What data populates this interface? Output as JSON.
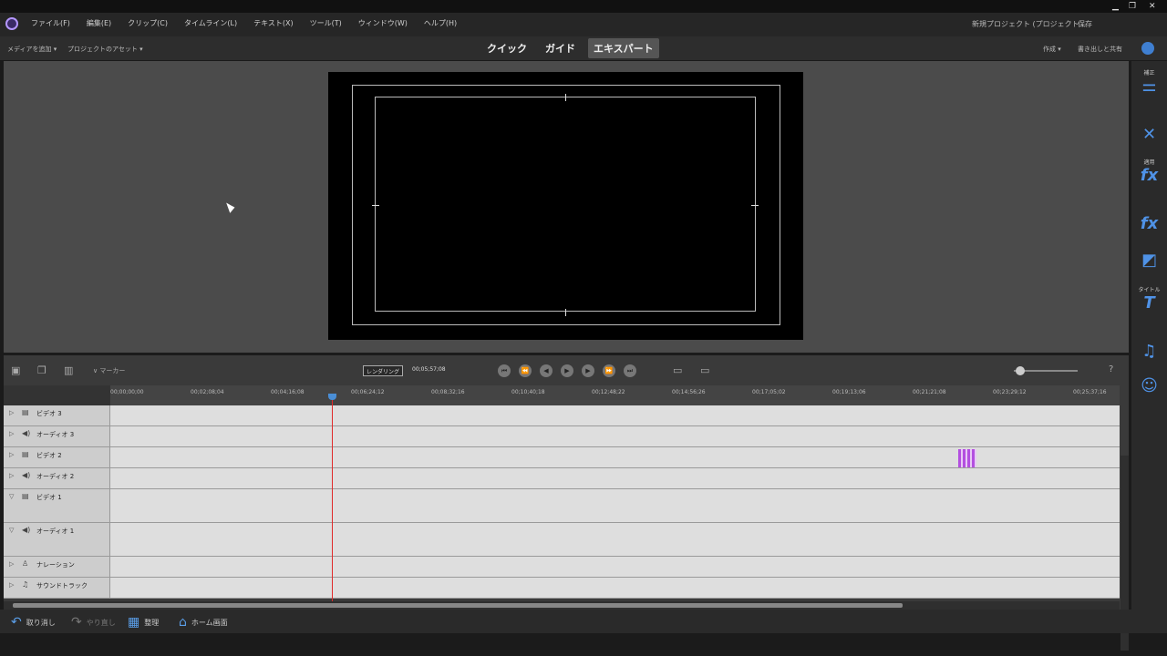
{
  "menu": [
    "ファイル(F)",
    "編集(E)",
    "クリップ(C)",
    "タイムライン(L)",
    "テキスト(X)",
    "ツール(T)",
    "ウィンドウ(W)",
    "ヘルプ(H)"
  ],
  "titlebar": {
    "doc_title": "新規プロジェクト (プロジェクト...",
    "save_label": "保存",
    "min": "▁",
    "max": "❐",
    "close": "✕"
  },
  "toolbar": {
    "media_import": "メディアを追加 ▾",
    "project_assets": "プロジェクトのアセット ▾",
    "modes": [
      "クイック",
      "ガイド",
      "エキスパート"
    ],
    "active_mode": "エキスパート",
    "create": "作成 ▾",
    "share": "書き出しと共有"
  },
  "right_panel": {
    "items": [
      {
        "label": "補正",
        "icon": "sliders-icon",
        "glyph": "⚌"
      },
      {
        "label": "",
        "icon": "tools-icon",
        "glyph": "✕"
      },
      {
        "label": "適用",
        "icon": "applied-fx-icon",
        "glyph": "fx"
      },
      {
        "label": "",
        "icon": "effects-icon",
        "glyph": "fx"
      },
      {
        "label": "",
        "icon": "transitions-icon",
        "glyph": "◩"
      },
      {
        "label": "タイトル",
        "icon": "titles-icon",
        "glyph": "T"
      },
      {
        "label": "",
        "icon": "music-icon",
        "glyph": "♫"
      },
      {
        "label": "",
        "icon": "graphics-icon",
        "glyph": "☺"
      }
    ]
  },
  "timeline": {
    "marker_label": "マーカー",
    "render_label": "レンダリング",
    "timecode": "00;05;57;08",
    "ruler": [
      "00;00;00;00",
      "00;02;08;04",
      "00;04;16;08",
      "00;06;24;12",
      "00;08;32;16",
      "00;10;40;18",
      "00;12;48;22",
      "00;14;56;26",
      "00;17;05;02",
      "00;19;13;06",
      "00;21;21;08",
      "00;23;29;12",
      "00;25;37;16"
    ],
    "tracks": [
      {
        "name": "ビデオ 3",
        "type": "video"
      },
      {
        "name": "オーディオ 3",
        "type": "audio"
      },
      {
        "name": "ビデオ 2",
        "type": "video"
      },
      {
        "name": "オーディオ 2",
        "type": "audio"
      },
      {
        "name": "ビデオ 1",
        "type": "video"
      },
      {
        "name": "オーディオ 1",
        "type": "audio"
      },
      {
        "name": "ナレーション",
        "type": "narration"
      },
      {
        "name": "サウンドトラック",
        "type": "music"
      }
    ]
  },
  "bottom": {
    "undo": "取り消し",
    "redo": "やり直し",
    "organizer": "整理",
    "home": "ホーム画面"
  }
}
